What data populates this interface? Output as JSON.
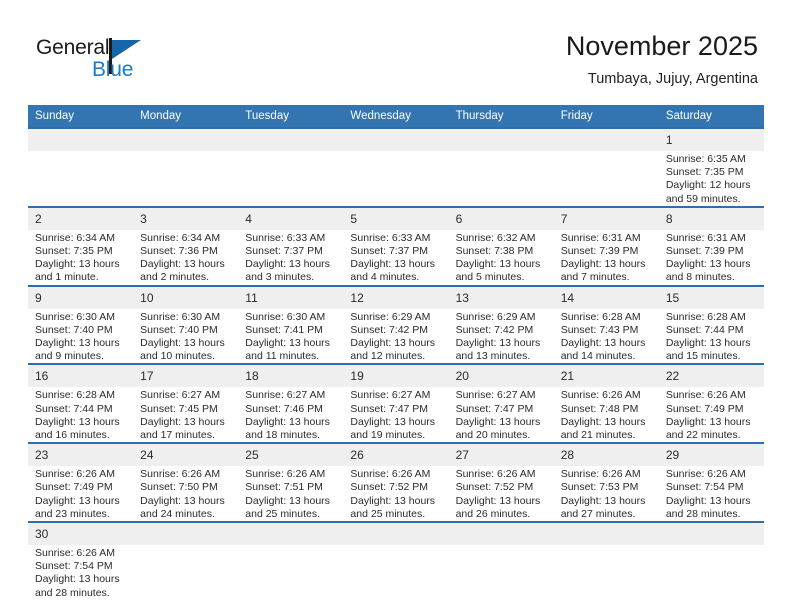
{
  "brand": {
    "name_top": "General",
    "name_bottom": "Blue",
    "color_black": "#1a1a1a",
    "color_blue": "#1e7ac4"
  },
  "header": {
    "title": "November 2025",
    "subtitle": "Tumbaya, Jujuy, Argentina"
  },
  "theme": {
    "header_blue": "#3275b0",
    "row_border_blue": "#2f6ea8",
    "daynum_band": "#efefef"
  },
  "weekdays": [
    "Sunday",
    "Monday",
    "Tuesday",
    "Wednesday",
    "Thursday",
    "Friday",
    "Saturday"
  ],
  "weeks": [
    [
      {
        "day": "",
        "empty": true
      },
      {
        "day": "",
        "empty": true
      },
      {
        "day": "",
        "empty": true
      },
      {
        "day": "",
        "empty": true
      },
      {
        "day": "",
        "empty": true
      },
      {
        "day": "",
        "empty": true
      },
      {
        "day": "1",
        "sunrise": "Sunrise: 6:35 AM",
        "sunset": "Sunset: 7:35 PM",
        "daylight1": "Daylight: 12 hours",
        "daylight2": "and 59 minutes."
      }
    ],
    [
      {
        "day": "2",
        "sunrise": "Sunrise: 6:34 AM",
        "sunset": "Sunset: 7:35 PM",
        "daylight1": "Daylight: 13 hours",
        "daylight2": "and 1 minute."
      },
      {
        "day": "3",
        "sunrise": "Sunrise: 6:34 AM",
        "sunset": "Sunset: 7:36 PM",
        "daylight1": "Daylight: 13 hours",
        "daylight2": "and 2 minutes."
      },
      {
        "day": "4",
        "sunrise": "Sunrise: 6:33 AM",
        "sunset": "Sunset: 7:37 PM",
        "daylight1": "Daylight: 13 hours",
        "daylight2": "and 3 minutes."
      },
      {
        "day": "5",
        "sunrise": "Sunrise: 6:33 AM",
        "sunset": "Sunset: 7:37 PM",
        "daylight1": "Daylight: 13 hours",
        "daylight2": "and 4 minutes."
      },
      {
        "day": "6",
        "sunrise": "Sunrise: 6:32 AM",
        "sunset": "Sunset: 7:38 PM",
        "daylight1": "Daylight: 13 hours",
        "daylight2": "and 5 minutes."
      },
      {
        "day": "7",
        "sunrise": "Sunrise: 6:31 AM",
        "sunset": "Sunset: 7:39 PM",
        "daylight1": "Daylight: 13 hours",
        "daylight2": "and 7 minutes."
      },
      {
        "day": "8",
        "sunrise": "Sunrise: 6:31 AM",
        "sunset": "Sunset: 7:39 PM",
        "daylight1": "Daylight: 13 hours",
        "daylight2": "and 8 minutes."
      }
    ],
    [
      {
        "day": "9",
        "sunrise": "Sunrise: 6:30 AM",
        "sunset": "Sunset: 7:40 PM",
        "daylight1": "Daylight: 13 hours",
        "daylight2": "and 9 minutes."
      },
      {
        "day": "10",
        "sunrise": "Sunrise: 6:30 AM",
        "sunset": "Sunset: 7:40 PM",
        "daylight1": "Daylight: 13 hours",
        "daylight2": "and 10 minutes."
      },
      {
        "day": "11",
        "sunrise": "Sunrise: 6:30 AM",
        "sunset": "Sunset: 7:41 PM",
        "daylight1": "Daylight: 13 hours",
        "daylight2": "and 11 minutes."
      },
      {
        "day": "12",
        "sunrise": "Sunrise: 6:29 AM",
        "sunset": "Sunset: 7:42 PM",
        "daylight1": "Daylight: 13 hours",
        "daylight2": "and 12 minutes."
      },
      {
        "day": "13",
        "sunrise": "Sunrise: 6:29 AM",
        "sunset": "Sunset: 7:42 PM",
        "daylight1": "Daylight: 13 hours",
        "daylight2": "and 13 minutes."
      },
      {
        "day": "14",
        "sunrise": "Sunrise: 6:28 AM",
        "sunset": "Sunset: 7:43 PM",
        "daylight1": "Daylight: 13 hours",
        "daylight2": "and 14 minutes."
      },
      {
        "day": "15",
        "sunrise": "Sunrise: 6:28 AM",
        "sunset": "Sunset: 7:44 PM",
        "daylight1": "Daylight: 13 hours",
        "daylight2": "and 15 minutes."
      }
    ],
    [
      {
        "day": "16",
        "sunrise": "Sunrise: 6:28 AM",
        "sunset": "Sunset: 7:44 PM",
        "daylight1": "Daylight: 13 hours",
        "daylight2": "and 16 minutes."
      },
      {
        "day": "17",
        "sunrise": "Sunrise: 6:27 AM",
        "sunset": "Sunset: 7:45 PM",
        "daylight1": "Daylight: 13 hours",
        "daylight2": "and 17 minutes."
      },
      {
        "day": "18",
        "sunrise": "Sunrise: 6:27 AM",
        "sunset": "Sunset: 7:46 PM",
        "daylight1": "Daylight: 13 hours",
        "daylight2": "and 18 minutes."
      },
      {
        "day": "19",
        "sunrise": "Sunrise: 6:27 AM",
        "sunset": "Sunset: 7:47 PM",
        "daylight1": "Daylight: 13 hours",
        "daylight2": "and 19 minutes."
      },
      {
        "day": "20",
        "sunrise": "Sunrise: 6:27 AM",
        "sunset": "Sunset: 7:47 PM",
        "daylight1": "Daylight: 13 hours",
        "daylight2": "and 20 minutes."
      },
      {
        "day": "21",
        "sunrise": "Sunrise: 6:26 AM",
        "sunset": "Sunset: 7:48 PM",
        "daylight1": "Daylight: 13 hours",
        "daylight2": "and 21 minutes."
      },
      {
        "day": "22",
        "sunrise": "Sunrise: 6:26 AM",
        "sunset": "Sunset: 7:49 PM",
        "daylight1": "Daylight: 13 hours",
        "daylight2": "and 22 minutes."
      }
    ],
    [
      {
        "day": "23",
        "sunrise": "Sunrise: 6:26 AM",
        "sunset": "Sunset: 7:49 PM",
        "daylight1": "Daylight: 13 hours",
        "daylight2": "and 23 minutes."
      },
      {
        "day": "24",
        "sunrise": "Sunrise: 6:26 AM",
        "sunset": "Sunset: 7:50 PM",
        "daylight1": "Daylight: 13 hours",
        "daylight2": "and 24 minutes."
      },
      {
        "day": "25",
        "sunrise": "Sunrise: 6:26 AM",
        "sunset": "Sunset: 7:51 PM",
        "daylight1": "Daylight: 13 hours",
        "daylight2": "and 25 minutes."
      },
      {
        "day": "26",
        "sunrise": "Sunrise: 6:26 AM",
        "sunset": "Sunset: 7:52 PM",
        "daylight1": "Daylight: 13 hours",
        "daylight2": "and 25 minutes."
      },
      {
        "day": "27",
        "sunrise": "Sunrise: 6:26 AM",
        "sunset": "Sunset: 7:52 PM",
        "daylight1": "Daylight: 13 hours",
        "daylight2": "and 26 minutes."
      },
      {
        "day": "28",
        "sunrise": "Sunrise: 6:26 AM",
        "sunset": "Sunset: 7:53 PM",
        "daylight1": "Daylight: 13 hours",
        "daylight2": "and 27 minutes."
      },
      {
        "day": "29",
        "sunrise": "Sunrise: 6:26 AM",
        "sunset": "Sunset: 7:54 PM",
        "daylight1": "Daylight: 13 hours",
        "daylight2": "and 28 minutes."
      }
    ],
    [
      {
        "day": "30",
        "sunrise": "Sunrise: 6:26 AM",
        "sunset": "Sunset: 7:54 PM",
        "daylight1": "Daylight: 13 hours",
        "daylight2": "and 28 minutes."
      },
      {
        "day": "",
        "empty": true
      },
      {
        "day": "",
        "empty": true
      },
      {
        "day": "",
        "empty": true
      },
      {
        "day": "",
        "empty": true
      },
      {
        "day": "",
        "empty": true
      },
      {
        "day": "",
        "empty": true
      }
    ]
  ]
}
